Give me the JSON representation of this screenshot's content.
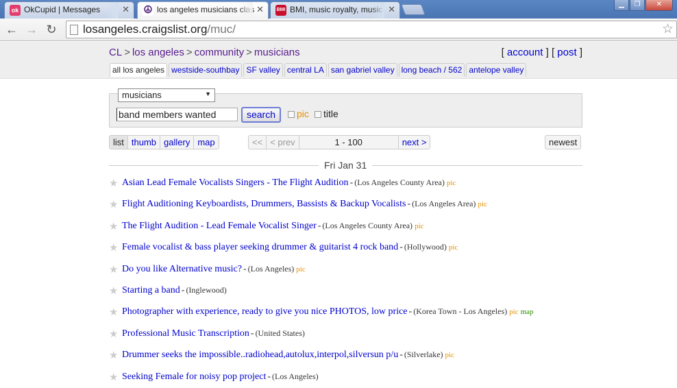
{
  "browser": {
    "tabs": [
      {
        "title": "OkCupid | Messages",
        "favicon": "okcupid-favicon",
        "active": false
      },
      {
        "title": "los angeles musicians clas",
        "favicon": "peace-favicon",
        "active": true
      },
      {
        "title": "BMI, music royalty, music",
        "favicon": "bmi-favicon",
        "active": false
      }
    ],
    "url_host": "losangeles.craigslist.org",
    "url_path": "/muc/"
  },
  "header": {
    "breadcrumbs": [
      "CL",
      "los angeles",
      "community",
      "musicians"
    ],
    "account": "account",
    "post": "post",
    "subareas": [
      "all los angeles",
      "westside-southbay",
      "SF valley",
      "central LA",
      "san gabriel valley",
      "long beach / 562",
      "antelope valley"
    ]
  },
  "search": {
    "category": "musicians",
    "query": "band members wanted",
    "button": "search",
    "pic_label": "pic",
    "title_label": "title"
  },
  "views": {
    "modes": [
      "list",
      "thumb",
      "gallery",
      "map"
    ],
    "first": "<<",
    "prev": "< prev",
    "range": "1 - 100",
    "next": "next >",
    "sort": "newest"
  },
  "date_heading": "Fri Jan 31",
  "listings": [
    {
      "title": "Asian Lead Female Vocalists Singers - The Flight Audition",
      "location": "(Los Angeles County Area)",
      "pic": "pic",
      "map": ""
    },
    {
      "title": "Flight Auditioning Keyboardists, Drummers, Bassists & Backup Vocalists",
      "location": "(Los Angeles Area)",
      "pic": "pic",
      "map": ""
    },
    {
      "title": "The Flight Audition - Lead Female Vocalist Singer",
      "location": "(Los Angeles County Area)",
      "pic": "pic",
      "map": ""
    },
    {
      "title": "Female vocalist & bass player seeking drummer & guitarist 4 rock band",
      "location": "(Hollywood)",
      "pic": "pic",
      "map": ""
    },
    {
      "title": "Do you like Alternative music?",
      "location": "(Los Angeles)",
      "pic": "pic",
      "map": ""
    },
    {
      "title": "Starting a band",
      "location": "(Inglewood)",
      "pic": "",
      "map": ""
    },
    {
      "title": "Photographer with experience, ready to give you nice PHOTOS, low price",
      "location": "(Korea Town - Los Angeles)",
      "pic": "pic",
      "map": "map"
    },
    {
      "title": "Professional Music Transcription",
      "location": "(United States)",
      "pic": "",
      "map": ""
    },
    {
      "title": "Drummer seeks the impossible..radiohead,autolux,interpol,silversun p/u",
      "location": "(Silverlake)",
      "pic": "pic",
      "map": ""
    },
    {
      "title": "Seeking Female for noisy pop project",
      "location": "(Los Angeles)",
      "pic": "",
      "map": ""
    }
  ]
}
